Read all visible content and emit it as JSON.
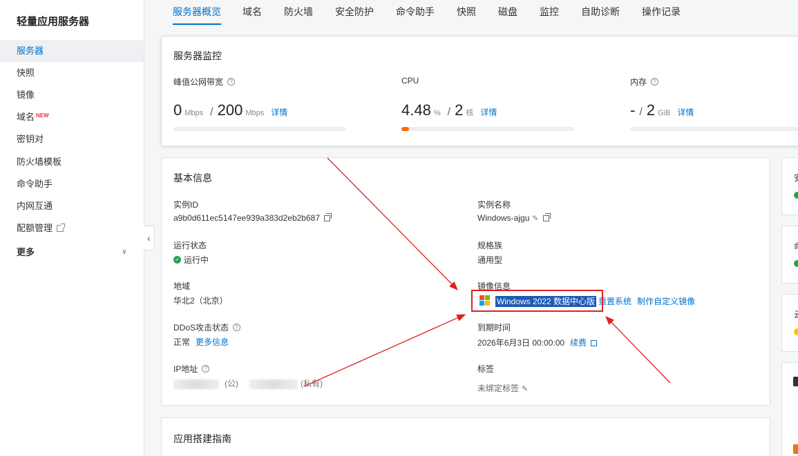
{
  "sidebar": {
    "title": "轻量应用服务器",
    "items": [
      {
        "label": "服务器"
      },
      {
        "label": "快照"
      },
      {
        "label": "镜像"
      },
      {
        "label": "域名",
        "badge": "NEW"
      },
      {
        "label": "密钥对"
      },
      {
        "label": "防火墙模板"
      },
      {
        "label": "命令助手"
      },
      {
        "label": "内网互通"
      },
      {
        "label": "配额管理"
      },
      {
        "label": "更多"
      }
    ]
  },
  "tabs": [
    "服务器概览",
    "域名",
    "防火墙",
    "安全防护",
    "命令助手",
    "快照",
    "磁盘",
    "监控",
    "自助诊断",
    "操作记录"
  ],
  "monitor": {
    "title": "服务器监控",
    "bandwidth": {
      "label": "峰值公网带宽",
      "used": "0",
      "used_unit": "Mbps",
      "sep": "/",
      "total": "200",
      "total_unit": "Mbps",
      "link": "详情",
      "fraction": 0
    },
    "cpu": {
      "label": "CPU",
      "used": "4.48",
      "used_unit": "%",
      "sep": "/",
      "total": "2",
      "total_unit": "核",
      "link": "详情",
      "fraction": 0.0448
    },
    "memory": {
      "label": "内存",
      "used": "-",
      "sep": "/",
      "total": "2",
      "total_unit": "GiB",
      "link": "详情",
      "fraction": 0
    }
  },
  "basic_info": {
    "title": "基本信息",
    "instance_id": {
      "label": "实例ID",
      "value": "a9b0d611ec5147ee939a383d2eb2b687"
    },
    "instance_name": {
      "label": "实例名称",
      "value": "Windows-ajgu"
    },
    "run_status": {
      "label": "运行状态",
      "value": "运行中"
    },
    "spec_family": {
      "label": "规格族",
      "value": "通用型"
    },
    "region": {
      "label": "地域",
      "value": "华北2（北京）"
    },
    "image": {
      "label": "镜像信息",
      "value": "Windows 2022 数据中心版",
      "action1": "重置系统",
      "action2": "制作自定义镜像"
    },
    "ddos": {
      "label": "DDoS攻击状态",
      "value": "正常",
      "link": "更多信息"
    },
    "expire": {
      "label": "到期时间",
      "value": "2026年6月3日 00:00:00",
      "link": "续费"
    },
    "ip": {
      "label": "IP地址",
      "public_suffix": "(公)",
      "private_suffix": "(私有)"
    },
    "tags": {
      "label": "标签",
      "value": "未绑定标签"
    }
  },
  "guide": {
    "title": "应用搭建指南"
  },
  "right_panel": {
    "texts": [
      "安",
      "命",
      "云"
    ]
  },
  "colors": {
    "accent": "#0070cc",
    "cpu_bar": "#ff6a00",
    "ok": "#22a34b",
    "annotation": "#e02020"
  }
}
